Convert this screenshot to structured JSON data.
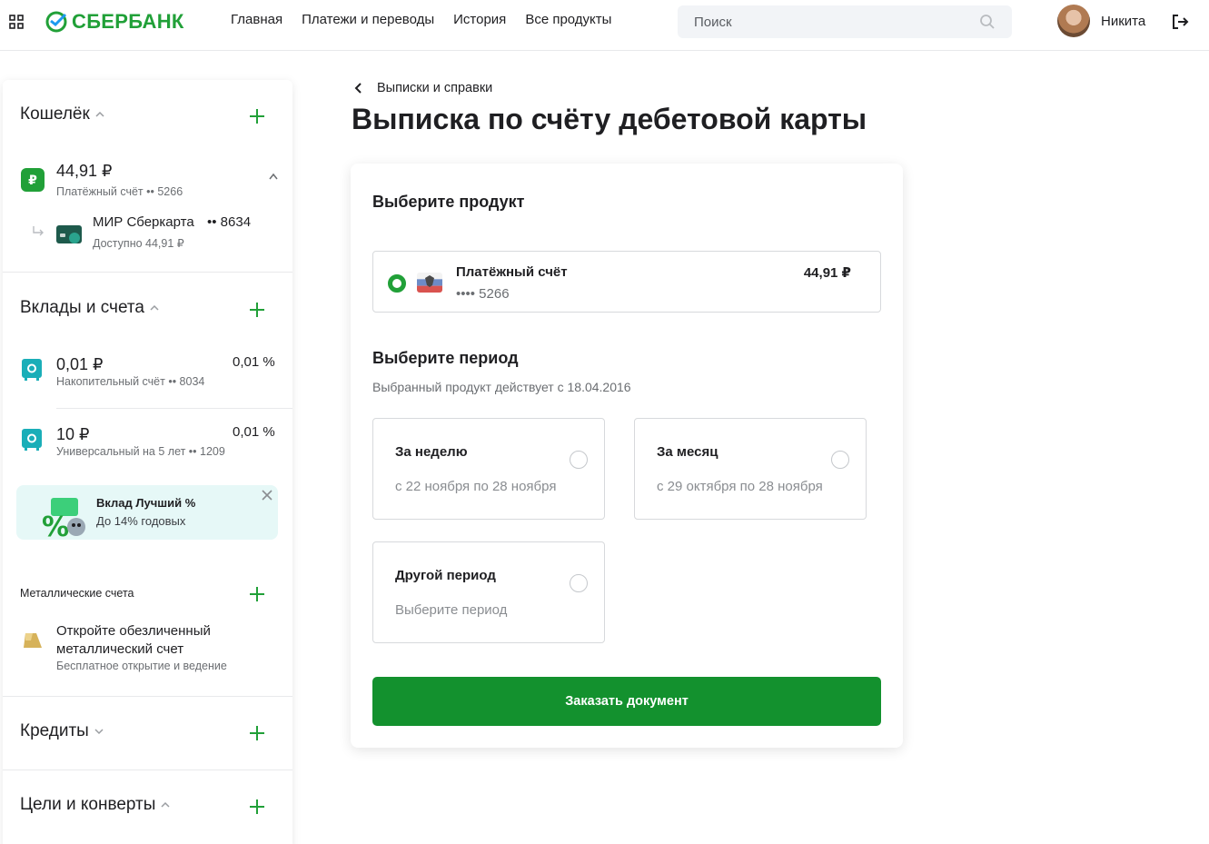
{
  "header": {
    "logo_text": "СБЕРБАНК",
    "nav": [
      "Главная",
      "Платежи и переводы",
      "История",
      "Все продукты"
    ],
    "search_placeholder": "Поиск",
    "user_name": "Никита"
  },
  "sidebar": {
    "wallet": {
      "title": "Кошелёк",
      "account_amount": "44,91 ₽",
      "account_label": "Платёжный счёт •• 5266",
      "card_name": "МИР Сберкарта",
      "card_number": "•• 8634",
      "card_available": "Доступно 44,91 ₽"
    },
    "deposits": {
      "title": "Вклады и счета",
      "items": [
        {
          "amount": "0,01 ₽",
          "label": "Накопительный счёт •• 8034",
          "rate": "0,01 %"
        },
        {
          "amount": "10 ₽",
          "label": "Универсальный на 5 лет •• 1209",
          "rate": "0,01 %"
        }
      ],
      "promo_title": "Вклад Лучший %",
      "promo_sub": "До 14% годовых"
    },
    "metal": {
      "title": "Металлические счета",
      "line1": "Откройте обезличенный",
      "line2": "металлический счет",
      "sub": "Бесплатное открытие и ведение"
    },
    "credits_title": "Кредиты",
    "goals_title": "Цели и конверты"
  },
  "main": {
    "breadcrumb": "Выписки и справки",
    "title": "Выписка по счёту дебетовой карты",
    "choose_product": "Выберите продукт",
    "product": {
      "name": "Платёжный счёт",
      "number": "•••• 5266",
      "amount": "44,91 ₽"
    },
    "choose_period": "Выберите период",
    "period_note": "Выбранный продукт действует с 18.04.2016",
    "periods": [
      {
        "title": "За неделю",
        "sub": "с 22 ноября по 28 ноября"
      },
      {
        "title": "За месяц",
        "sub": "с 29 октября по 28 ноября"
      },
      {
        "title": "Другой период",
        "sub": "Выберите период"
      }
    ],
    "order_button": "Заказать документ"
  },
  "colors": {
    "brand_green": "#21a038",
    "button_green": "#13912e"
  }
}
